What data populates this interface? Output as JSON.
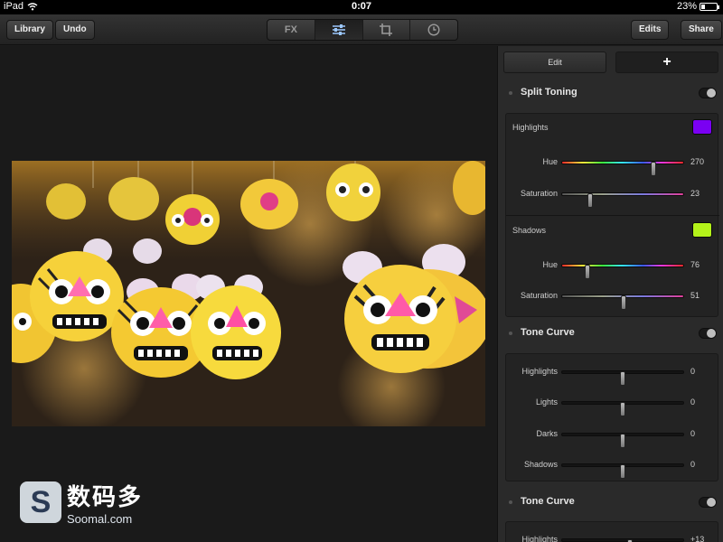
{
  "status": {
    "device": "iPad",
    "time": "0:07",
    "battery_text": "23%",
    "battery_level": 0.23
  },
  "toolbar": {
    "library_label": "Library",
    "undo_label": "Undo",
    "segments": [
      {
        "kind": "text",
        "label": "FX"
      },
      {
        "kind": "icon",
        "icon": "sliders-icon"
      },
      {
        "kind": "icon",
        "icon": "crop-icon"
      },
      {
        "kind": "icon",
        "icon": "history-clock-icon"
      }
    ],
    "edits_label": "Edits",
    "share_label": "Share"
  },
  "panel": {
    "tab_edit": "Edit",
    "tab_add": "+",
    "split_toning": {
      "title": "Split Toning",
      "highlights": {
        "label": "Highlights",
        "color": "#7a00f2"
      },
      "highlights_sliders": [
        {
          "label": "Hue",
          "value": "270",
          "position": 0.75,
          "style": "hue"
        },
        {
          "label": "Saturation",
          "value": "23",
          "position": 0.23,
          "style": "sat"
        }
      ],
      "shadows": {
        "label": "Shadows",
        "color": "#b3f21a"
      },
      "shadows_sliders": [
        {
          "label": "Hue",
          "value": "76",
          "position": 0.21,
          "style": "hue"
        },
        {
          "label": "Saturation",
          "value": "51",
          "position": 0.51,
          "style": "sat"
        }
      ]
    },
    "tone_curve_1": {
      "title": "Tone Curve",
      "sliders": [
        {
          "label": "Highlights",
          "value": "0",
          "position": 0.5
        },
        {
          "label": "Lights",
          "value": "0",
          "position": 0.5
        },
        {
          "label": "Darks",
          "value": "0",
          "position": 0.5
        },
        {
          "label": "Shadows",
          "value": "0",
          "position": 0.5
        }
      ]
    },
    "tone_curve_2": {
      "title": "Tone Curve",
      "sliders": [
        {
          "label": "Highlights",
          "value": "+13",
          "position": 0.56
        }
      ]
    }
  },
  "watermark": {
    "logo_letter": "S",
    "cn": "数码多",
    "en": "Soomal.com"
  }
}
